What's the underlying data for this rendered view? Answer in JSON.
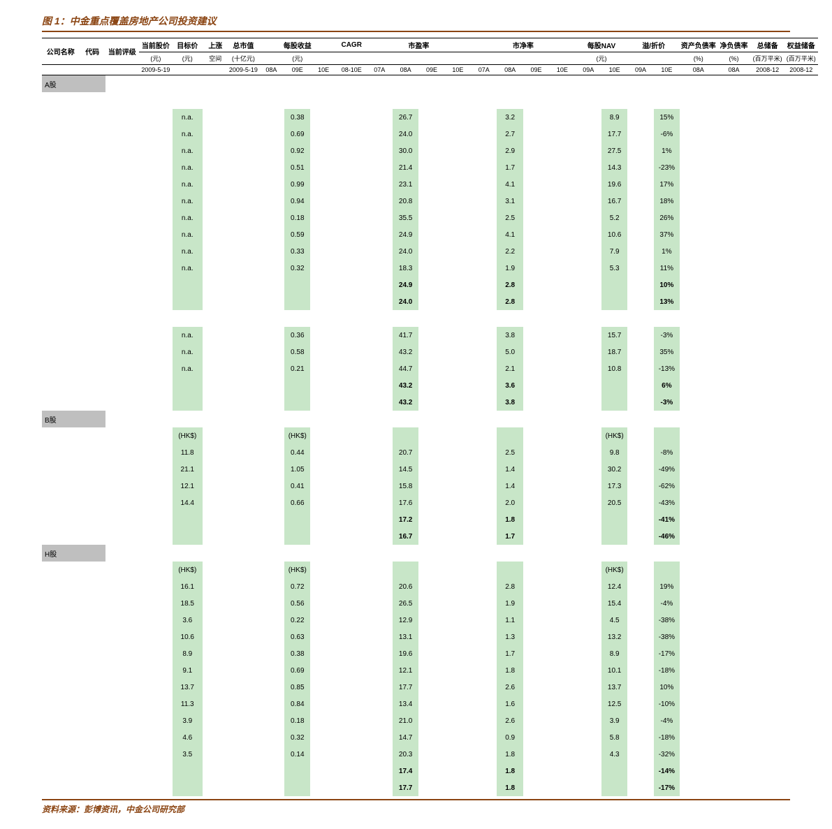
{
  "caption": "图 1：中金重点覆盖房地产公司投资建议",
  "footer": "资料来源：彭博资讯，中金公司研究部",
  "headers": {
    "row1": [
      "公司名称",
      "代码",
      "当前评级",
      "当前股价",
      "目标价",
      "上涨",
      "总市值",
      "每股收益",
      "CAGR",
      "市盈率",
      "市净率",
      "每股NAV",
      "溢/折价",
      "资产负债率",
      "净负债率",
      "总储备",
      "权益储备"
    ],
    "units": [
      "",
      "",
      "",
      "(元)",
      "(元)",
      "空间",
      "(十亿元)",
      "(元)",
      "",
      "",
      "",
      "(元)",
      "",
      "(%)",
      "(%)",
      "(百万平米)",
      "(百万平米)"
    ],
    "row2_dates": [
      "2009-5-19",
      "",
      "",
      "2009-5-19"
    ],
    "col_detail": [
      "08A",
      "09E",
      "10E",
      "08-10E",
      "07A",
      "08A",
      "09E",
      "10E",
      "07A",
      "08A",
      "09E",
      "10E",
      "09A",
      "10E",
      "09A",
      "10E",
      "08A",
      "08A",
      "2008-12",
      "2008-12"
    ]
  },
  "sections": {
    "a": "A股",
    "b": "B股",
    "h": "H股"
  },
  "currency_rows": {
    "hks": "(HK$)"
  },
  "a_rows": [
    {
      "price": "n.a.",
      "eps09": "0.38",
      "pe08": "26.7",
      "pb08": "3.2",
      "nav10": "8.9",
      "prem10": "15%"
    },
    {
      "price": "n.a.",
      "eps09": "0.69",
      "pe08": "24.0",
      "pb08": "2.7",
      "nav10": "17.7",
      "prem10": "-6%"
    },
    {
      "price": "n.a.",
      "eps09": "0.92",
      "pe08": "30.0",
      "pb08": "2.9",
      "nav10": "27.5",
      "prem10": "1%"
    },
    {
      "price": "n.a.",
      "eps09": "0.51",
      "pe08": "21.4",
      "pb08": "1.7",
      "nav10": "14.3",
      "prem10": "-23%"
    },
    {
      "price": "n.a.",
      "eps09": "0.99",
      "pe08": "23.1",
      "pb08": "4.1",
      "nav10": "19.6",
      "prem10": "17%"
    },
    {
      "price": "n.a.",
      "eps09": "0.94",
      "pe08": "20.8",
      "pb08": "3.1",
      "nav10": "16.7",
      "prem10": "18%"
    },
    {
      "price": "n.a.",
      "eps09": "0.18",
      "pe08": "35.5",
      "pb08": "2.5",
      "nav10": "5.2",
      "prem10": "26%"
    },
    {
      "price": "n.a.",
      "eps09": "0.59",
      "pe08": "24.9",
      "pb08": "4.1",
      "nav10": "10.6",
      "prem10": "37%"
    },
    {
      "price": "n.a.",
      "eps09": "0.33",
      "pe08": "24.0",
      "pb08": "2.2",
      "nav10": "7.9",
      "prem10": "1%"
    },
    {
      "price": "n.a.",
      "eps09": "0.32",
      "pe08": "18.3",
      "pb08": "1.9",
      "nav10": "5.3",
      "prem10": "11%"
    }
  ],
  "a_summary": [
    {
      "pe08": "24.9",
      "pb08": "2.8",
      "prem10": "10%"
    },
    {
      "pe08": "24.0",
      "pb08": "2.8",
      "prem10": "13%"
    }
  ],
  "a_rows2": [
    {
      "price": "n.a.",
      "eps09": "0.36",
      "pe08": "41.7",
      "pb08": "3.8",
      "nav10": "15.7",
      "prem10": "-3%"
    },
    {
      "price": "n.a.",
      "eps09": "0.58",
      "pe08": "43.2",
      "pb08": "5.0",
      "nav10": "18.7",
      "prem10": "35%"
    },
    {
      "price": "n.a.",
      "eps09": "0.21",
      "pe08": "44.7",
      "pb08": "2.1",
      "nav10": "10.8",
      "prem10": "-13%"
    }
  ],
  "a_summary2": [
    {
      "pe08": "43.2",
      "pb08": "3.6",
      "prem10": "6%"
    },
    {
      "pe08": "43.2",
      "pb08": "3.8",
      "prem10": "-3%"
    }
  ],
  "b_rows": [
    {
      "price": "11.8",
      "eps09": "0.44",
      "pe08": "20.7",
      "pb08": "2.5",
      "nav10": "9.8",
      "prem10": "-8%"
    },
    {
      "price": "21.1",
      "eps09": "1.05",
      "pe08": "14.5",
      "pb08": "1.4",
      "nav10": "30.2",
      "prem10": "-49%"
    },
    {
      "price": "12.1",
      "eps09": "0.41",
      "pe08": "15.8",
      "pb08": "1.4",
      "nav10": "17.3",
      "prem10": "-62%"
    },
    {
      "price": "14.4",
      "eps09": "0.66",
      "pe08": "17.6",
      "pb08": "2.0",
      "nav10": "20.5",
      "prem10": "-43%"
    }
  ],
  "b_summary": [
    {
      "pe08": "17.2",
      "pb08": "1.8",
      "prem10": "-41%"
    },
    {
      "pe08": "16.7",
      "pb08": "1.7",
      "prem10": "-46%"
    }
  ],
  "h_rows": [
    {
      "price": "16.1",
      "eps09": "0.72",
      "pe08": "20.6",
      "pb08": "2.8",
      "nav10": "12.4",
      "prem10": "19%"
    },
    {
      "price": "18.5",
      "eps09": "0.56",
      "pe08": "26.5",
      "pb08": "1.9",
      "nav10": "15.4",
      "prem10": "-4%"
    },
    {
      "price": "3.6",
      "eps09": "0.22",
      "pe08": "12.9",
      "pb08": "1.1",
      "nav10": "4.5",
      "prem10": "-38%"
    },
    {
      "price": "10.6",
      "eps09": "0.63",
      "pe08": "13.1",
      "pb08": "1.3",
      "nav10": "13.2",
      "prem10": "-38%"
    },
    {
      "price": "8.9",
      "eps09": "0.38",
      "pe08": "19.6",
      "pb08": "1.7",
      "nav10": "8.9",
      "prem10": "-17%"
    },
    {
      "price": "9.1",
      "eps09": "0.69",
      "pe08": "12.1",
      "pb08": "1.8",
      "nav10": "10.1",
      "prem10": "-18%"
    },
    {
      "price": "13.7",
      "eps09": "0.85",
      "pe08": "17.7",
      "pb08": "2.6",
      "nav10": "13.7",
      "prem10": "10%"
    },
    {
      "price": "11.3",
      "eps09": "0.84",
      "pe08": "13.4",
      "pb08": "1.6",
      "nav10": "12.5",
      "prem10": "-10%"
    },
    {
      "price": "3.9",
      "eps09": "0.18",
      "pe08": "21.0",
      "pb08": "2.6",
      "nav10": "3.9",
      "prem10": "-4%"
    },
    {
      "price": "4.6",
      "eps09": "0.32",
      "pe08": "14.7",
      "pb08": "0.9",
      "nav10": "5.8",
      "prem10": "-18%"
    },
    {
      "price": "3.5",
      "eps09": "0.14",
      "pe08": "20.3",
      "pb08": "1.8",
      "nav10": "4.3",
      "prem10": "-32%"
    }
  ],
  "h_summary": [
    {
      "pe08": "17.4",
      "pb08": "1.8",
      "prem10": "-14%"
    },
    {
      "pe08": "17.7",
      "pb08": "1.8",
      "prem10": "-17%"
    }
  ]
}
